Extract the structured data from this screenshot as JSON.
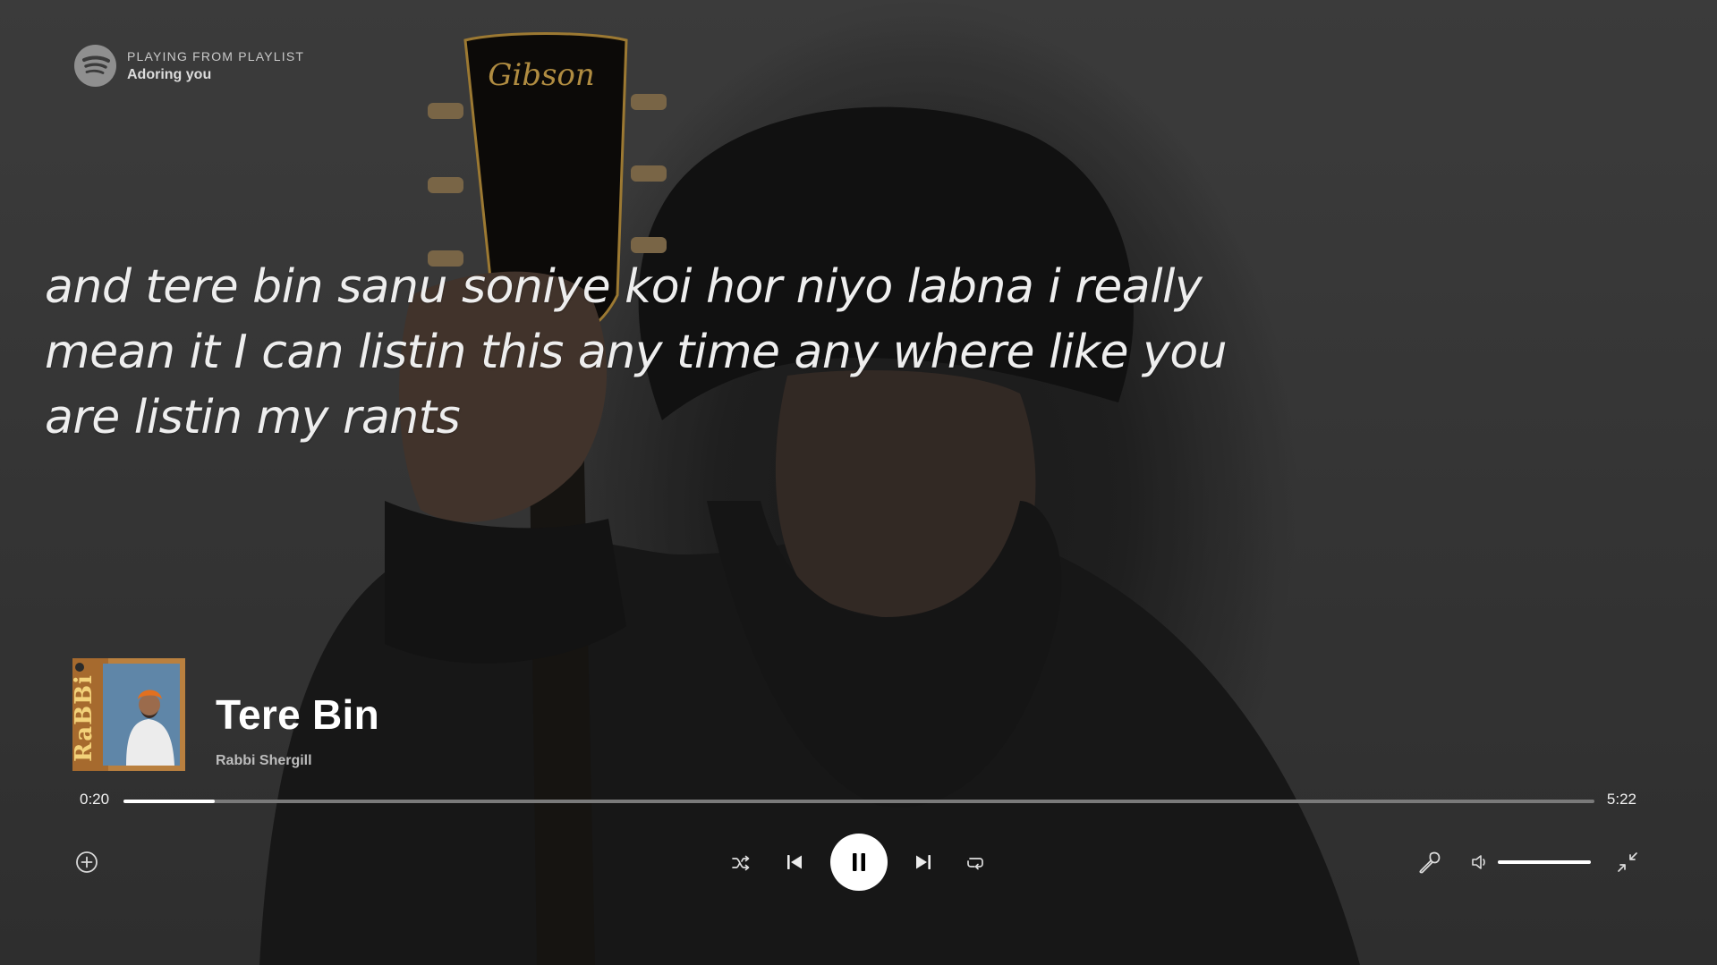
{
  "header": {
    "context_label": "PLAYING FROM PLAYLIST",
    "playlist_name": "Adoring you"
  },
  "lyrics": {
    "text": "and tere bin sanu soniye koi hor niyo labna i really mean it  I can listin this any time any where like you are listin my rants"
  },
  "track": {
    "title": "Tere Bin",
    "artist": "Rabbi Shergill",
    "cover_text": "RaBBi"
  },
  "playback": {
    "elapsed": "0:20",
    "duration": "5:22",
    "progress_fraction": 0.062,
    "volume_fraction": 1.0,
    "state": "playing"
  },
  "icons": {
    "logo": "spotify-logo-icon",
    "add": "add-circle-icon",
    "shuffle": "shuffle-icon",
    "previous": "skip-previous-icon",
    "pause": "pause-icon",
    "next": "skip-next-icon",
    "repeat": "repeat-icon",
    "lyrics": "microphone-icon",
    "volume": "volume-icon",
    "minimize": "exit-fullscreen-icon"
  },
  "colors": {
    "background": "#3b3b3b",
    "accent": "#ffffff",
    "track_inactive": "#7a7a7a"
  }
}
